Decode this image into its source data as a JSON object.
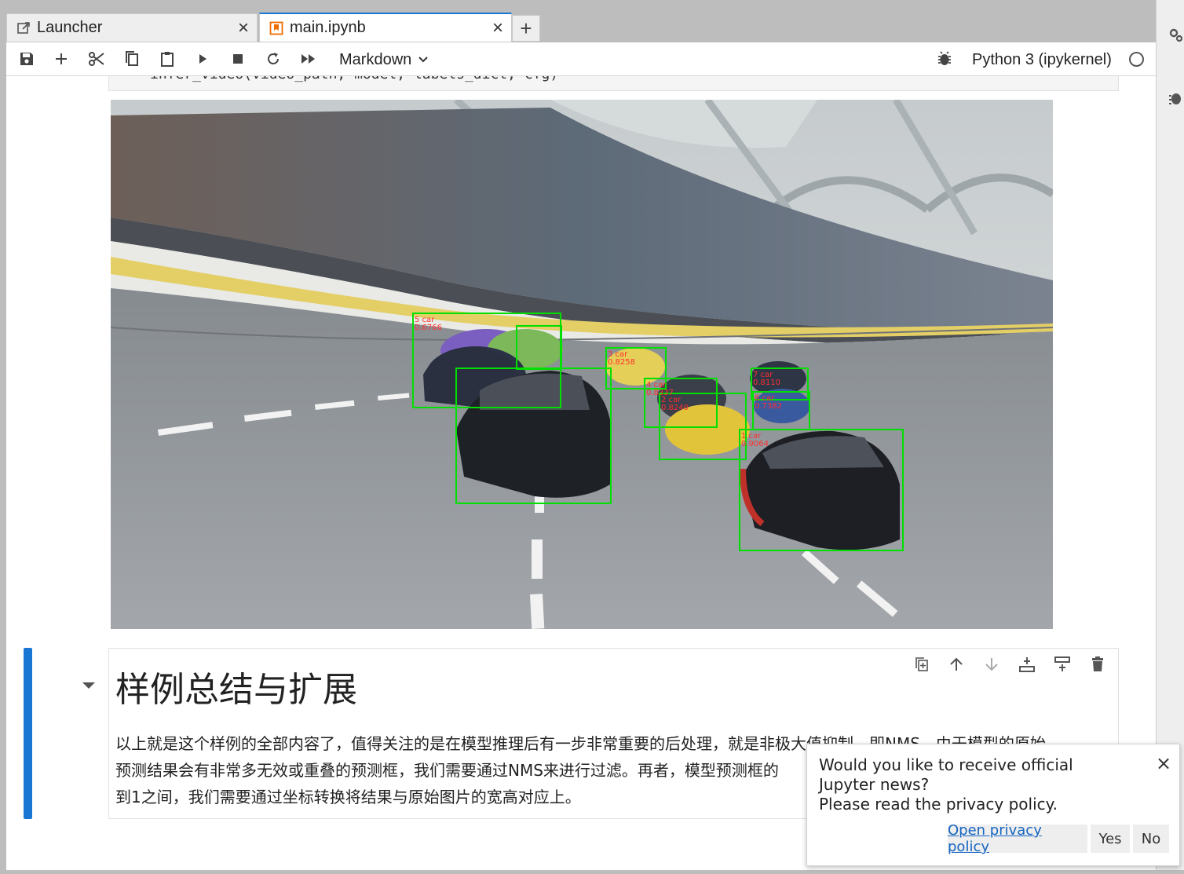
{
  "tabs": [
    {
      "label": "Launcher",
      "icon": "launcher-icon",
      "close": "×"
    },
    {
      "label": "main.ipynb",
      "icon": "notebook-icon",
      "close": "×"
    }
  ],
  "new_tab": "+",
  "toolbar": {
    "cell_type": "Markdown",
    "kernel_name": "Python 3 (ipykernel)",
    "icons": [
      "save-icon",
      "add-cell-icon",
      "cut-icon",
      "copy-icon",
      "paste-icon",
      "run-icon",
      "stop-icon",
      "restart-icon",
      "run-all-icon"
    ],
    "kernel_status": "idle"
  },
  "code_cell": {
    "source": "infer_video(video_path, model, labels_dict, cfg)"
  },
  "output": {
    "detections": [
      {
        "label": "5 car",
        "score": "0.6766"
      },
      {
        "label": "3 car",
        "score": "0.8258"
      },
      {
        "label": "2 car",
        "score": "0.8240"
      },
      {
        "label": "7 car",
        "score": "0.8110"
      },
      {
        "label": "6 car",
        "score": "0.7382"
      },
      {
        "label": "1 car",
        "score": "0.9064"
      },
      {
        "label": "4 car",
        "score": "0.8337"
      }
    ],
    "box_color": "#00e000",
    "label_color": "#ff3030"
  },
  "markdown_cell": {
    "heading": "样例总结与扩展",
    "paragraph_lines": [
      "以上就是这个样例的全部内容了，值得关注的是在模型推理后有一步非常重要的后处理，就是非极大值抑制，即NMS。由于模型的原始",
      "预测结果会有非常多无效或重叠的预测框，我们需要通过NMS来进行过滤。再者，模型预测框的",
      "到1之间，我们需要通过坐标转换将结果与原始图片的宽高对应上。"
    ]
  },
  "toast": {
    "message_line1": "Would you like to receive official Jupyter news?",
    "message_line2": "Please read the privacy policy.",
    "close": "×",
    "buttons": {
      "privacy": "Open privacy policy",
      "yes": "Yes",
      "no": "No"
    }
  },
  "colors": {
    "accent": "#1976d2",
    "detection_box": "#00e000"
  }
}
